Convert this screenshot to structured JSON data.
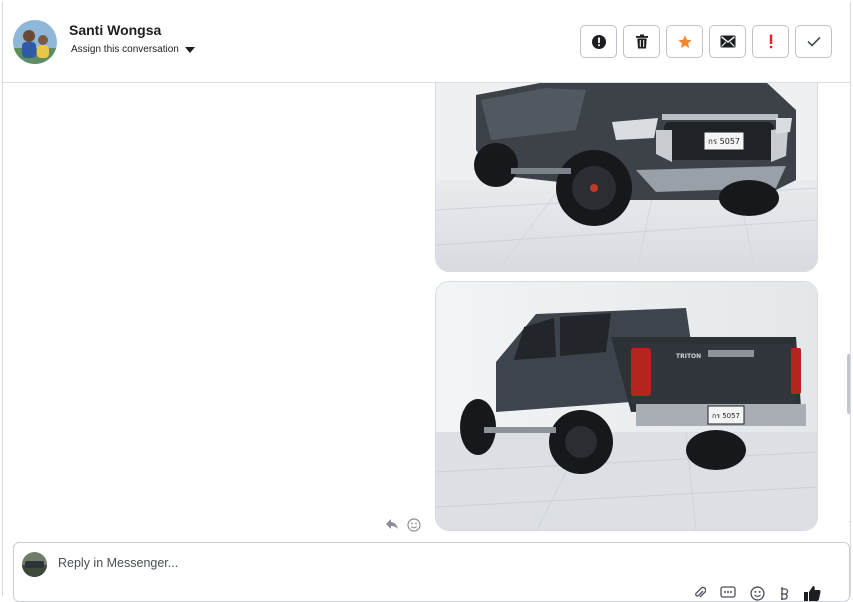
{
  "header": {
    "contact_name": "Santi Wongsa",
    "assign_label": "Assign this conversation",
    "actions": [
      {
        "name": "spam",
        "icon": "alert-circle-icon"
      },
      {
        "name": "delete",
        "icon": "trash-icon"
      },
      {
        "name": "star",
        "icon": "star-icon"
      },
      {
        "name": "mark-unread",
        "icon": "envelope-icon"
      },
      {
        "name": "important",
        "icon": "exclamation-icon"
      },
      {
        "name": "done",
        "icon": "check-icon"
      }
    ]
  },
  "thread": {
    "images": [
      {
        "description": "truck-front-photo",
        "plate": "กร 5057"
      },
      {
        "description": "truck-rear-photo",
        "plate": "กร 5057",
        "badge": "TRITON"
      }
    ]
  },
  "composer": {
    "placeholder": "Reply in Messenger..."
  },
  "colors": {
    "star": "#f5862c",
    "exclamation": "#e02424",
    "border": "#dadde1"
  }
}
